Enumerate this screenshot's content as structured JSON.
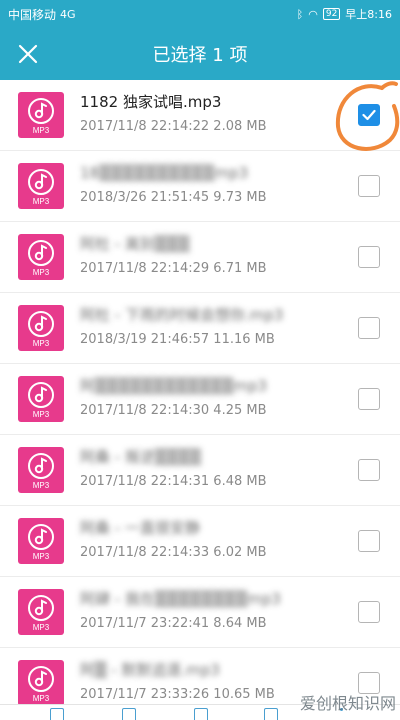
{
  "status_bar": {
    "carrier": "中国移动",
    "signal": "4G",
    "battery": "92",
    "time": "早上8:16"
  },
  "toolbar": {
    "title": "已选择 1 项",
    "close_icon": "close-icon"
  },
  "file_ext_label": "MP3",
  "files": [
    {
      "name": "1182 独家试唱.mp3",
      "meta": "2017/11/8 22:14:22 2.08 MB",
      "checked": true,
      "blurred": false
    },
    {
      "name": "18▒▒▒▒▒▒▒▒▒▒mp3",
      "meta": "2018/3/26 21:51:45 9.73 MB",
      "checked": false,
      "blurred": true
    },
    {
      "name": "阿杜 - 离别▒▒▒",
      "meta": "2017/11/8 22:14:29 6.71 MB",
      "checked": false,
      "blurred": true
    },
    {
      "name": "阿杜 - 下雨的时候会想你.mp3",
      "meta": "2018/3/19 21:46:57 11.16 MB",
      "checked": false,
      "blurred": true
    },
    {
      "name": "阿▒▒▒▒▒▒▒▒▒▒▒▒mp3",
      "meta": "2017/11/8 22:14:30 4.25 MB",
      "checked": false,
      "blurred": true
    },
    {
      "name": "阿桑 - 叛逆▒▒▒▒",
      "meta": "2017/11/8 22:14:31 6.48 MB",
      "checked": false,
      "blurred": true
    },
    {
      "name": "阿桑 - 一直很安静",
      "meta": "2017/11/8 22:14:33 6.02 MB",
      "checked": false,
      "blurred": true
    },
    {
      "name": "阿肆 - 我在▒▒▒▒▒▒▒▒mp3",
      "meta": "2017/11/7 23:22:41 8.64 MB",
      "checked": false,
      "blurred": true
    },
    {
      "name": "阿▒ - 默默追逐.mp3",
      "meta": "2017/11/7 23:33:26 10.65 MB",
      "checked": false,
      "blurred": true
    }
  ],
  "watermark": "爱创根知识网",
  "colors": {
    "accent": "#2aa9c7",
    "file_icon": "#e73a8c",
    "checkbox_checked": "#1e8fe6",
    "annotation": "#f0883a"
  }
}
